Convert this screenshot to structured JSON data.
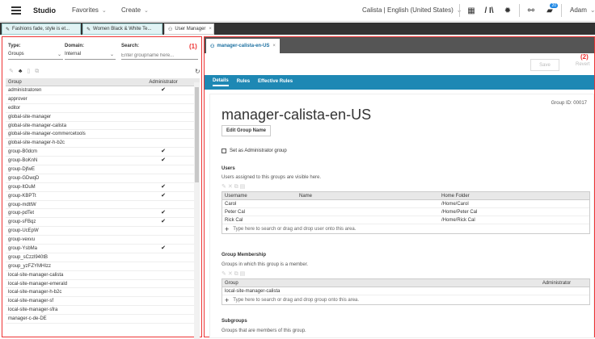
{
  "topbar": {
    "brand": "Studio",
    "favorites": "Favorites",
    "create": "Create",
    "user_region": "Calista | English (United States)",
    "notification_count": "20",
    "user_name": "Adam"
  },
  "doc_tabs": [
    {
      "label": "Fashions fade, style is et..."
    },
    {
      "label": "Women Black & White Te..."
    },
    {
      "label": "User Manager"
    }
  ],
  "left_panel": {
    "number": "(1)",
    "type_label": "Type:",
    "type_value": "Groups",
    "domain_label": "Domain:",
    "domain_value": "Internal",
    "search_label": "Search:",
    "search_placeholder": "Enter groupname here...",
    "col_group": "Group",
    "col_admin": "Administrator",
    "rows": [
      {
        "name": "administratoren",
        "admin": "✔"
      },
      {
        "name": "approver",
        "admin": ""
      },
      {
        "name": "editor",
        "admin": ""
      },
      {
        "name": "global-site-manager",
        "admin": ""
      },
      {
        "name": "global-site-manager-calista",
        "admin": ""
      },
      {
        "name": "global-site-manager-commercetools",
        "admin": ""
      },
      {
        "name": "global-site-manager-h-b2c",
        "admin": ""
      },
      {
        "name": "group-B0dcm",
        "admin": "✔"
      },
      {
        "name": "group-BoKnN",
        "admin": "✔"
      },
      {
        "name": "group-DjfwE",
        "admin": ""
      },
      {
        "name": "group-GDwqD",
        "admin": ""
      },
      {
        "name": "group-ItOuM",
        "admin": "✔"
      },
      {
        "name": "group-KBPTt",
        "admin": "✔"
      },
      {
        "name": "group-mdttW",
        "admin": ""
      },
      {
        "name": "group-pdTet",
        "admin": "✔"
      },
      {
        "name": "group-sFBqz",
        "admin": "✔"
      },
      {
        "name": "group-UcEpW",
        "admin": ""
      },
      {
        "name": "group-vexvu",
        "admin": ""
      },
      {
        "name": "group-YsbMa",
        "admin": "✔"
      },
      {
        "name": "group_sCzzl940tB",
        "admin": ""
      },
      {
        "name": "group_yzFZYMHIzz",
        "admin": ""
      },
      {
        "name": "local-site-manager-calista",
        "admin": ""
      },
      {
        "name": "local-site-manager-emerald",
        "admin": ""
      },
      {
        "name": "local-site-manager-h-b2c",
        "admin": ""
      },
      {
        "name": "local-site-manager-sf",
        "admin": ""
      },
      {
        "name": "local-site-manager-sfra",
        "admin": ""
      },
      {
        "name": "manager-c-de-DE",
        "admin": ""
      }
    ]
  },
  "right_panel": {
    "number": "(2)",
    "tab_label": "manager-calista-en-US",
    "save_label": "Save",
    "revert_label": "Revert",
    "tabs": [
      "Details",
      "Rules",
      "Effective Rules"
    ],
    "group_id": "Group ID: 00017",
    "title": "manager-calista-en-US",
    "edit_button": "Edit Group Name",
    "admin_checkbox_label": "Set as Administrator group",
    "users_title": "Users",
    "users_desc": "Users assigned to this groups are visible here.",
    "users_cols": [
      "Username",
      "Name",
      "Home Folder"
    ],
    "users_rows": [
      {
        "username": "Carol",
        "name": "",
        "home": "/Home/Carol"
      },
      {
        "username": "Peter Cal",
        "name": "",
        "home": "/Home/Peter Cal"
      },
      {
        "username": "Rick Cal",
        "name": "",
        "home": "/Home/Rick Cal"
      }
    ],
    "users_add_placeholder": "Type here to search or drag and drop user onto this area.",
    "membership_title": "Group Membership",
    "membership_desc": "Groups in which this group is a member.",
    "membership_cols": [
      "Group",
      "Administrator"
    ],
    "membership_rows": [
      {
        "group": "local-site-manager-calista",
        "admin": ""
      }
    ],
    "membership_add_placeholder": "Type here to search or drag and drop group onto this area.",
    "subgroups_title": "Subgroups",
    "subgroups_desc": "Groups that are members of this group."
  }
}
